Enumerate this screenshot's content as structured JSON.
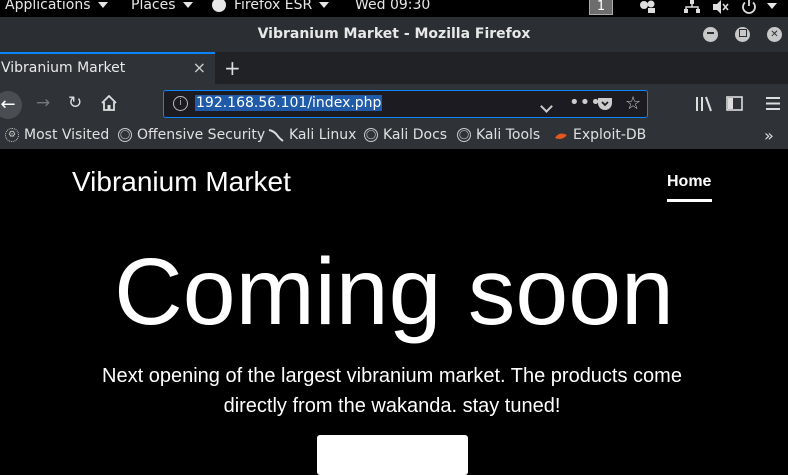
{
  "system_bar": {
    "applications": "Applications",
    "places": "Places",
    "firefox": "Firefox ESR",
    "clock": "Wed 09:30",
    "workspace": "1"
  },
  "window": {
    "title": "Vibranium Market - Mozilla Firefox"
  },
  "tabs": [
    {
      "label": "Vibranium Market"
    }
  ],
  "nav": {
    "url": "192.168.56.101/index.php"
  },
  "bookmarks": [
    {
      "label": "Most Visited",
      "icon": "gear-icon"
    },
    {
      "label": "Offensive Security",
      "icon": "globe-icon"
    },
    {
      "label": "Kali Linux",
      "icon": "kali-dragon-icon"
    },
    {
      "label": "Kali Docs",
      "icon": "globe-icon"
    },
    {
      "label": "Kali Tools",
      "icon": "globe-icon"
    },
    {
      "label": "Exploit-DB",
      "icon": "exploit-db-icon"
    }
  ],
  "page": {
    "brand": "Vibranium Market",
    "nav_home": "Home",
    "heading": "Coming soon",
    "lead": "Next opening of the largest vibranium market. The products come directly from the wakanda. stay tuned!"
  },
  "colors": {
    "accent": "#0a84ff",
    "page_background": "#000000",
    "toolbar": "#2f3237"
  }
}
